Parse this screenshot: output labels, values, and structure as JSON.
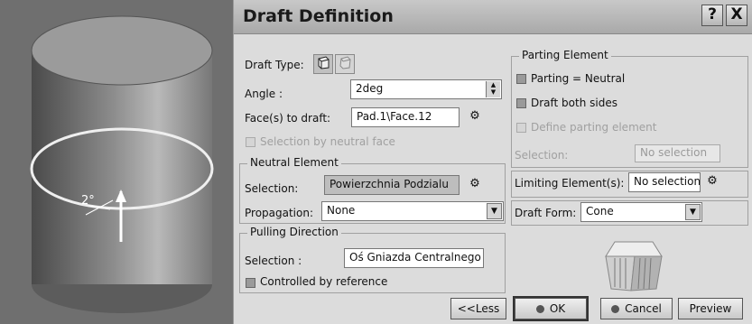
{
  "dialog": {
    "title": "Draft Definition",
    "help_label": "?",
    "close_label": "X",
    "draft_type_label": "Draft Type:",
    "angle_label": "Angle :",
    "angle_value": "2deg",
    "faces_label": "Face(s) to draft:",
    "faces_value": "Pad.1\\Face.12",
    "selection_by_neutral_face": "Selection by neutral face",
    "neutral_element": {
      "title": "Neutral Element",
      "selection_label": "Selection:",
      "selection_value": "Powierzchnia Podzialu",
      "propagation_label": "Propagation:",
      "propagation_value": "None"
    },
    "pulling_direction": {
      "title": "Pulling Direction",
      "selection_label": "Selection :",
      "selection_value": "Oś Gniazda Centralnego",
      "controlled_by_reference": "Controlled by reference"
    },
    "parting_element": {
      "title": "Parting Element",
      "parting_neutral": "Parting = Neutral",
      "draft_both_sides": "Draft both sides",
      "define_parting_element": "Define parting element",
      "selection_label": "Selection:",
      "selection_value": "No selection"
    },
    "limiting": {
      "label": "Limiting Element(s):",
      "value": "No selection"
    },
    "draft_form": {
      "label": "Draft Form:",
      "value": "Cone"
    },
    "buttons": {
      "less": "<<Less",
      "ok": "OK",
      "cancel": "Cancel",
      "preview": "Preview"
    }
  },
  "viewport": {
    "angle_annotation": "2°"
  }
}
